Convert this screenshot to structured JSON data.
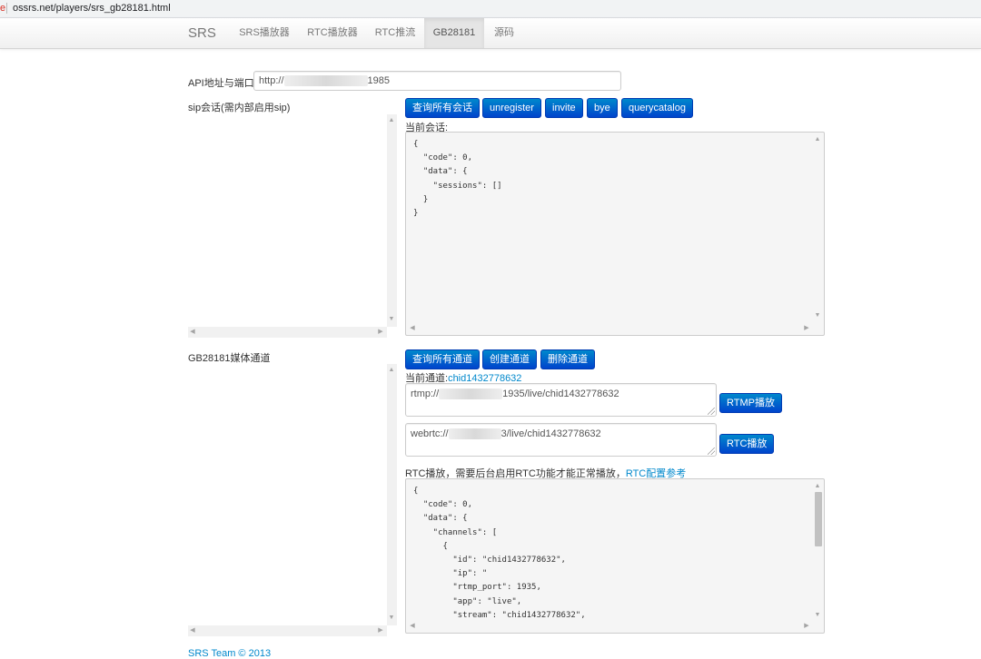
{
  "browser": {
    "url": "ossrs.net/players/srs_gb28181.html"
  },
  "nav": {
    "brand": "SRS",
    "items": [
      "SRS播放器",
      "RTC播放器",
      "RTC推流",
      "GB28181",
      "源码"
    ],
    "active": "GB28181"
  },
  "api": {
    "label": "API地址与端口",
    "value_prefix": "http://",
    "value_suffix": "1985"
  },
  "sip": {
    "label": "sip会话(需内部启用sip)",
    "buttons": [
      "查询所有会话",
      "unregister",
      "invite",
      "bye",
      "querycatalog"
    ],
    "current_label": "当前会话:",
    "code_lines": [
      "{",
      "  \"code\": 0,",
      "  \"data\": {",
      "    \"sessions\": []",
      "  }",
      "}"
    ]
  },
  "gb": {
    "label": "GB28181媒体通道",
    "channels": [
      "chid1432778632"
    ],
    "buttons": [
      "查询所有通道",
      "创建通道",
      "删除通道"
    ],
    "current_label": "当前通道:",
    "current_channel": "chid1432778632",
    "rtmp_prefix": "rtmp://",
    "rtmp_suffix": "1935/live/chid1432778632",
    "rtmp_button": "RTMP播放",
    "webrtc_prefix": "webrtc://",
    "webrtc_suffix": "3/live/chid1432778632",
    "rtc_button": "RTC播放",
    "rtc_note": "RTC播放，需要后台启用RTC功能才能正常播放，",
    "rtc_link": "RTC配置参考",
    "code_lines": [
      "{",
      "  \"code\": 0,",
      "  \"data\": {",
      "    \"channels\": [",
      "      {",
      "        \"id\": \"chid1432778632\",",
      "        \"ip\": \"",
      "        \"rtmp_port\": 1935,",
      "        \"app\": \"live\",",
      "        \"stream\": \"chid1432778632\","
    ]
  },
  "footer": {
    "text": "SRS Team © 2013"
  }
}
